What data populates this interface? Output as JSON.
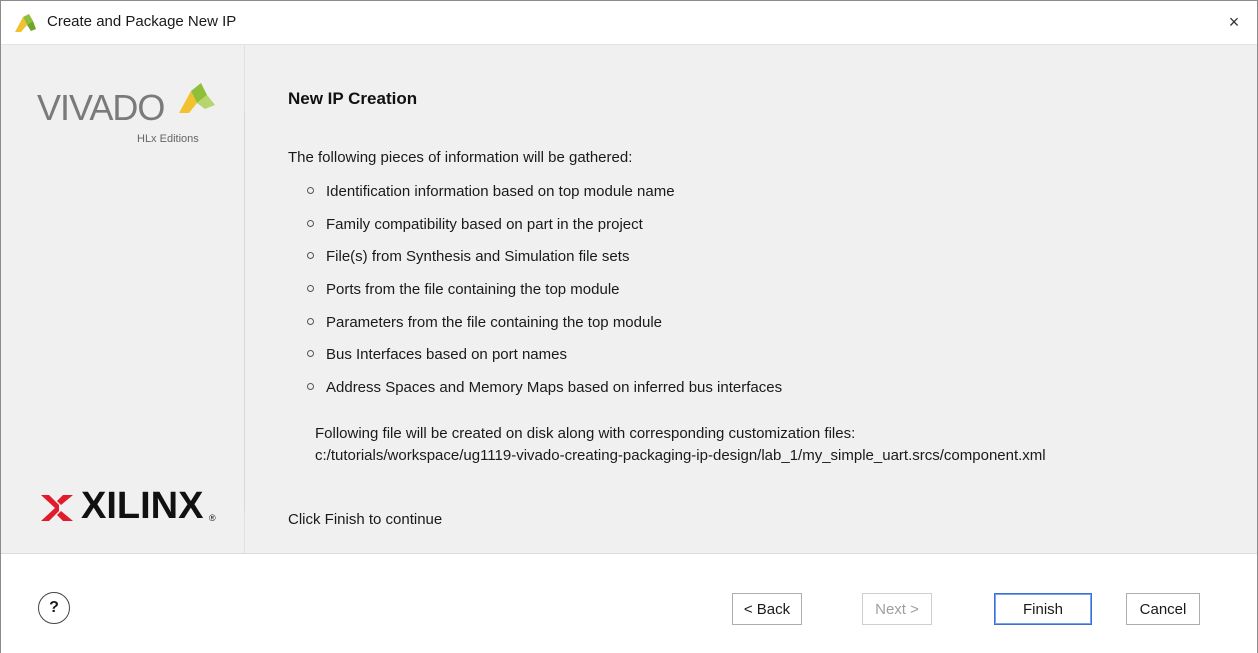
{
  "window": {
    "title": "Create and Package New IP",
    "close_glyph": "×",
    "icon": "vivado-app-icon"
  },
  "branding": {
    "vivado_word": "VIVADO",
    "hlx_text": "HLx Editions",
    "xilinx_word": "XILINX",
    "xilinx_reg": "®"
  },
  "content": {
    "heading": "New IP Creation",
    "intro": "The following pieces of information will be gathered:",
    "bullets": [
      "Identification information based on top module name",
      "Family compatibility based on part in the project",
      "File(s) from Synthesis and Simulation file sets",
      "Ports from the file containing the top module",
      "Parameters from the file containing the top module",
      "Bus Interfaces based on port names",
      "Address Spaces and Memory Maps based on inferred bus interfaces"
    ],
    "file_note_line1": "Following file will be created on disk along with corresponding customization files:",
    "file_note_line2": "c:/tutorials/workspace/ug1119-vivado-creating-packaging-ip-design/lab_1/my_simple_uart.srcs/component.xml",
    "continue_text": "Click Finish to continue"
  },
  "footer": {
    "help_label": "?",
    "back_label": "< Back",
    "next_label": "Next >",
    "finish_label": "Finish",
    "cancel_label": "Cancel"
  },
  "colors": {
    "vivado_green": "#8fbf3a",
    "vivado_yellow": "#f2c12e",
    "xilinx_red": "#e21b2b",
    "finish_border": "#3c6fd6",
    "panel_bg": "#f0f0f0"
  }
}
